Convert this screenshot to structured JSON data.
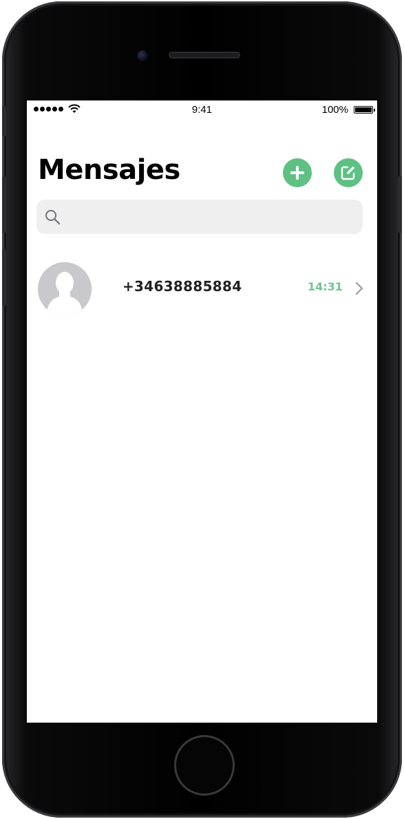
{
  "status_bar": {
    "time": "9:41",
    "battery": "100%",
    "signal_icon": "signal-dots-icon",
    "wifi_icon": "wifi-icon",
    "battery_icon": "battery-icon"
  },
  "header": {
    "title": "Mensajes",
    "add_icon": "plus-icon",
    "compose_icon": "compose-icon"
  },
  "search": {
    "placeholder": "",
    "value": "",
    "icon": "search-icon"
  },
  "conversations": [
    {
      "name": "+34638885884",
      "time": "14:31",
      "avatar_icon": "default-avatar-icon",
      "chevron_icon": "chevron-right-icon"
    }
  ],
  "colors": {
    "accent": "#5ec183",
    "time_text": "#6cc58f",
    "search_bg": "#efefef",
    "avatar_bg": "#c9c9cc"
  }
}
